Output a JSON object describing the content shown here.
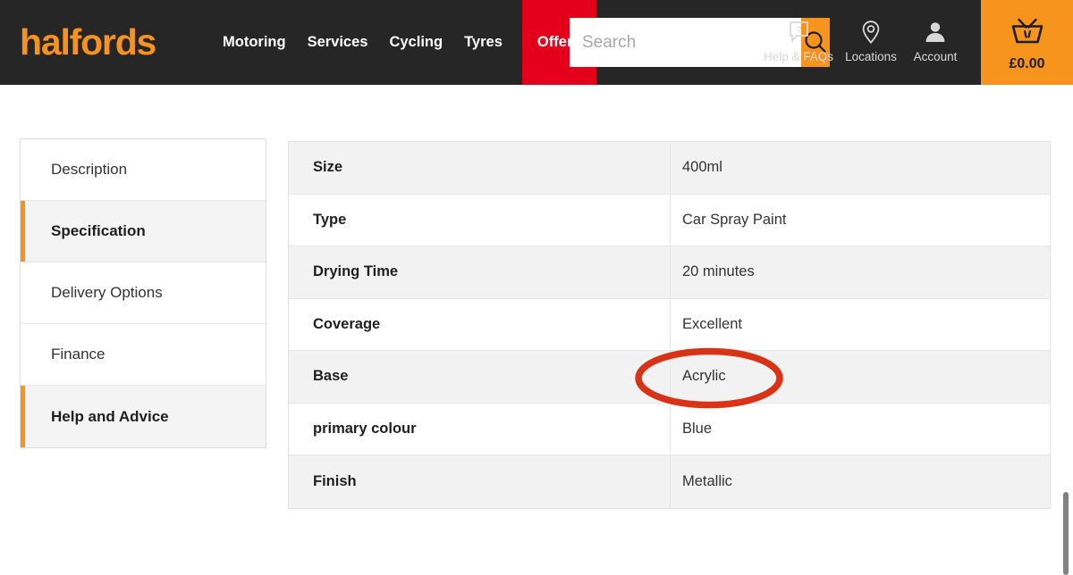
{
  "header": {
    "logo_text": "halfords",
    "logo_color": "#F6921E",
    "bg_color": "#262626",
    "nav_items": [
      {
        "label": "Motoring",
        "highlight": false
      },
      {
        "label": "Services",
        "highlight": false
      },
      {
        "label": "Cycling",
        "highlight": false
      },
      {
        "label": "Tyres",
        "highlight": false
      },
      {
        "label": "Offers",
        "highlight": true
      }
    ],
    "offers_bg_color": "#E4001B",
    "search": {
      "placeholder": "Search",
      "value": "",
      "button_icon": "search-icon",
      "button_color": "#F7941E"
    },
    "utils": [
      {
        "label": "Help & FAQs",
        "icon": "help-question-bubble-icon"
      },
      {
        "label": "Locations",
        "icon": "location-pin-icon"
      },
      {
        "label": "Account",
        "icon": "person-account-icon"
      }
    ],
    "basket": {
      "icon": "basket-icon",
      "amount": "£0.00",
      "bg_color": "#F7941E"
    }
  },
  "sidebar": {
    "items": [
      {
        "label": "Description",
        "active": false
      },
      {
        "label": "Specification",
        "active": true
      },
      {
        "label": "Delivery Options",
        "active": false
      },
      {
        "label": "Finance",
        "active": false
      },
      {
        "label": "Help and Advice",
        "active": true
      }
    ],
    "active_accent_color": "#F7941E"
  },
  "spec_table": {
    "rows": [
      {
        "key": "Size",
        "value": "400ml"
      },
      {
        "key": "Type",
        "value": "Car Spray Paint"
      },
      {
        "key": "Drying Time",
        "value": "20 minutes"
      },
      {
        "key": "Coverage",
        "value": "Excellent"
      },
      {
        "key": "Base",
        "value": "Acrylic"
      },
      {
        "key": "primary colour",
        "value": "Blue"
      },
      {
        "key": "Finish",
        "value": "Metallic"
      }
    ]
  },
  "annotation": {
    "shape": "ellipse",
    "color": "#D83317",
    "targets_value": "Acrylic"
  },
  "scrollbar": {
    "orientation": "vertical",
    "thumb_color": "#828282"
  }
}
